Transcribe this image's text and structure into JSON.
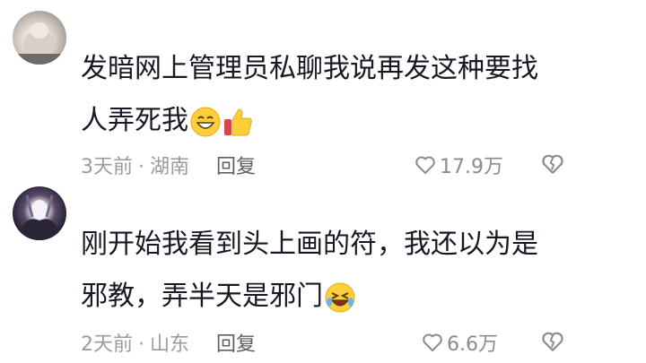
{
  "comments": [
    {
      "avatar_icon": "avatar-image",
      "text_line1": "发暗网上管理员私聊我说再发这种要找",
      "text_line2": "人弄死我",
      "emojis": [
        "grinning-face-icon",
        "thumbs-up-icon"
      ],
      "time": "3天前",
      "location": "湖南",
      "reply_label": "回复",
      "likes": "17.9万"
    },
    {
      "avatar_icon": "avatar-image",
      "text_line1": "刚开始我看到头上画的符，我还以为是",
      "text_line2": "邪教，弄半天是邪门",
      "emojis": [
        "laughing-face-icon"
      ],
      "time": "2天前",
      "location": "山东",
      "reply_label": "回复",
      "likes": "6.6万"
    }
  ],
  "separator": "·"
}
